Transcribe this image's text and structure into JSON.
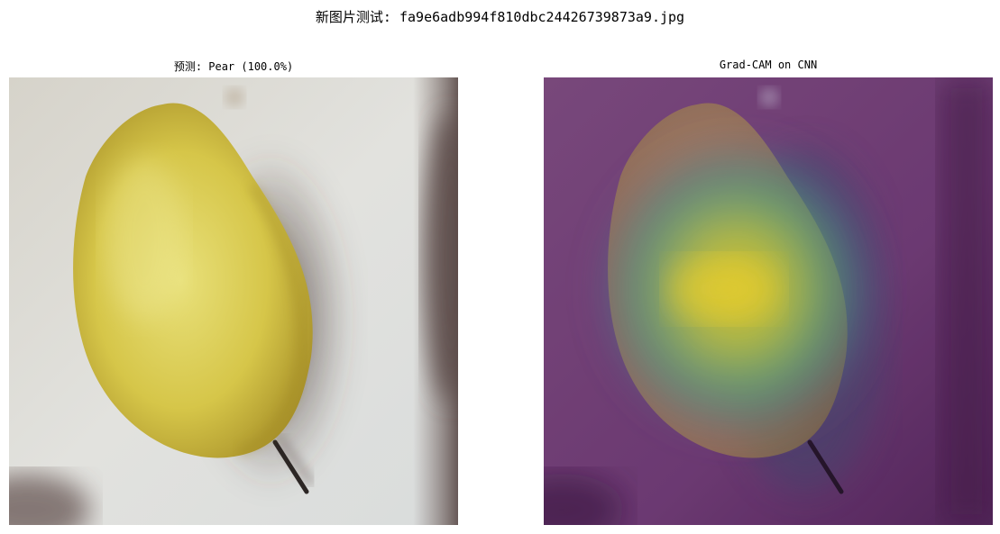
{
  "figure": {
    "suptitle": "新图片测试: fa9e6adb994f810dbc24426739873a9.jpg"
  },
  "panels": [
    {
      "title": "预测: Pear (100.0%)"
    },
    {
      "title": "Grad-CAM on CNN"
    }
  ],
  "colors": {
    "background": "#ffffff",
    "pear_yellow": "#d8c84a",
    "overlay_purple": "#6e3a74",
    "heat_yellow": "#f2dc1e",
    "heat_green": "#6cc36a"
  }
}
